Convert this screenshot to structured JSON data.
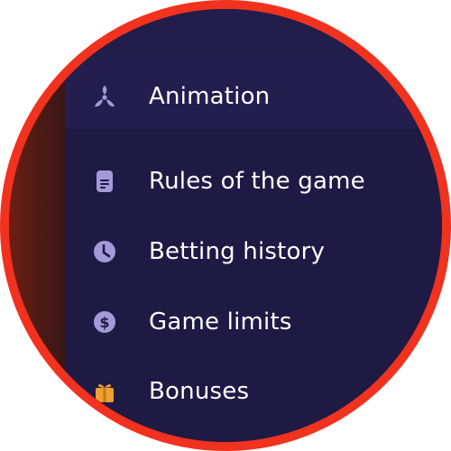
{
  "menu": {
    "items": [
      {
        "label": "Animation",
        "icon": "fan-icon"
      },
      {
        "label": "Rules of the game",
        "icon": "document-icon"
      },
      {
        "label": "Betting history",
        "icon": "clock-icon"
      },
      {
        "label": "Game limits",
        "icon": "dollar-coin-icon"
      },
      {
        "label": "Bonuses",
        "icon": "gift-icon"
      }
    ]
  },
  "colors": {
    "border": "#f0321e",
    "menu_bg": "#1e1a44",
    "icon_purple": "#a49ad8",
    "gift_orange": "#f0a030",
    "text": "#ffffff"
  }
}
